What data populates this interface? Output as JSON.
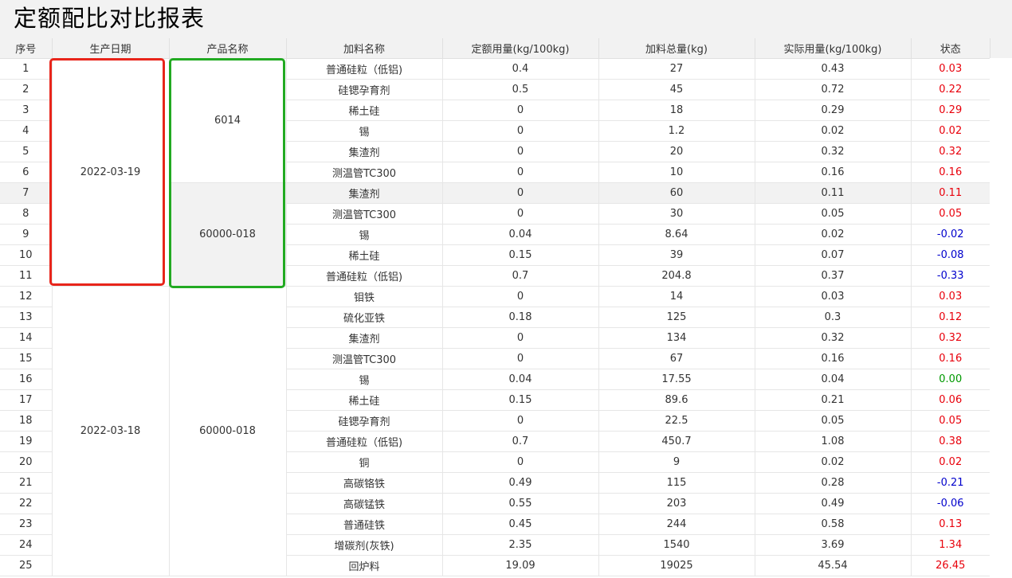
{
  "title": "定额配比对比报表",
  "columns": [
    "序号",
    "生产日期",
    "产品名称",
    "加料名称",
    "定额用量(kg/100kg)",
    "加料总量(kg)",
    "实际用量(kg/100kg)",
    "状态"
  ],
  "groups": {
    "date_a": "2022-03-19",
    "date_b": "2022-03-18",
    "product_a": "6014",
    "product_b": "60000-018",
    "product_c": "60000-018"
  },
  "rows": [
    {
      "seq": "1",
      "material": "普通硅粒（低铝)",
      "quota": "0.4",
      "total": "27",
      "actual": "0.43",
      "status": "0.03"
    },
    {
      "seq": "2",
      "material": "硅锶孕育剂",
      "quota": "0.5",
      "total": "45",
      "actual": "0.72",
      "status": "0.22"
    },
    {
      "seq": "3",
      "material": "稀土硅",
      "quota": "0",
      "total": "18",
      "actual": "0.29",
      "status": "0.29"
    },
    {
      "seq": "4",
      "material": "锡",
      "quota": "0",
      "total": "1.2",
      "actual": "0.02",
      "status": "0.02"
    },
    {
      "seq": "5",
      "material": "集渣剂",
      "quota": "0",
      "total": "20",
      "actual": "0.32",
      "status": "0.32"
    },
    {
      "seq": "6",
      "material": "测温管TC300",
      "quota": "0",
      "total": "10",
      "actual": "0.16",
      "status": "0.16"
    },
    {
      "seq": "7",
      "material": "集渣剂",
      "quota": "0",
      "total": "60",
      "actual": "0.11",
      "status": "0.11"
    },
    {
      "seq": "8",
      "material": "测温管TC300",
      "quota": "0",
      "total": "30",
      "actual": "0.05",
      "status": "0.05"
    },
    {
      "seq": "9",
      "material": "锡",
      "quota": "0.04",
      "total": "8.64",
      "actual": "0.02",
      "status": "-0.02"
    },
    {
      "seq": "10",
      "material": "稀土硅",
      "quota": "0.15",
      "total": "39",
      "actual": "0.07",
      "status": "-0.08"
    },
    {
      "seq": "11",
      "material": "普通硅粒（低铝)",
      "quota": "0.7",
      "total": "204.8",
      "actual": "0.37",
      "status": "-0.33"
    },
    {
      "seq": "12",
      "material": "钼铁",
      "quota": "0",
      "total": "14",
      "actual": "0.03",
      "status": "0.03"
    },
    {
      "seq": "13",
      "material": "硫化亚铁",
      "quota": "0.18",
      "total": "125",
      "actual": "0.3",
      "status": "0.12"
    },
    {
      "seq": "14",
      "material": "集渣剂",
      "quota": "0",
      "total": "134",
      "actual": "0.32",
      "status": "0.32"
    },
    {
      "seq": "15",
      "material": "测温管TC300",
      "quota": "0",
      "total": "67",
      "actual": "0.16",
      "status": "0.16"
    },
    {
      "seq": "16",
      "material": "锡",
      "quota": "0.04",
      "total": "17.55",
      "actual": "0.04",
      "status": "0.00"
    },
    {
      "seq": "17",
      "material": "稀土硅",
      "quota": "0.15",
      "total": "89.6",
      "actual": "0.21",
      "status": "0.06"
    },
    {
      "seq": "18",
      "material": "硅锶孕育剂",
      "quota": "0",
      "total": "22.5",
      "actual": "0.05",
      "status": "0.05"
    },
    {
      "seq": "19",
      "material": "普通硅粒（低铝)",
      "quota": "0.7",
      "total": "450.7",
      "actual": "1.08",
      "status": "0.38"
    },
    {
      "seq": "20",
      "material": "铜",
      "quota": "0",
      "total": "9",
      "actual": "0.02",
      "status": "0.02"
    },
    {
      "seq": "21",
      "material": "高碳铬铁",
      "quota": "0.49",
      "total": "115",
      "actual": "0.28",
      "status": "-0.21"
    },
    {
      "seq": "22",
      "material": "高碳锰铁",
      "quota": "0.55",
      "total": "203",
      "actual": "0.49",
      "status": "-0.06"
    },
    {
      "seq": "23",
      "material": "普通硅铁",
      "quota": "0.45",
      "total": "244",
      "actual": "0.58",
      "status": "0.13"
    },
    {
      "seq": "24",
      "material": "增碳剂(灰铁)",
      "quota": "2.35",
      "total": "1540",
      "actual": "3.69",
      "status": "1.34"
    },
    {
      "seq": "25",
      "material": "回炉料",
      "quota": "19.09",
      "total": "19025",
      "actual": "45.54",
      "status": "26.45"
    }
  ],
  "colors": {
    "positive": "#e8000b",
    "negative": "#0000cc",
    "zero": "#009900",
    "box_red": "#e8251b",
    "box_green": "#22aa22"
  }
}
